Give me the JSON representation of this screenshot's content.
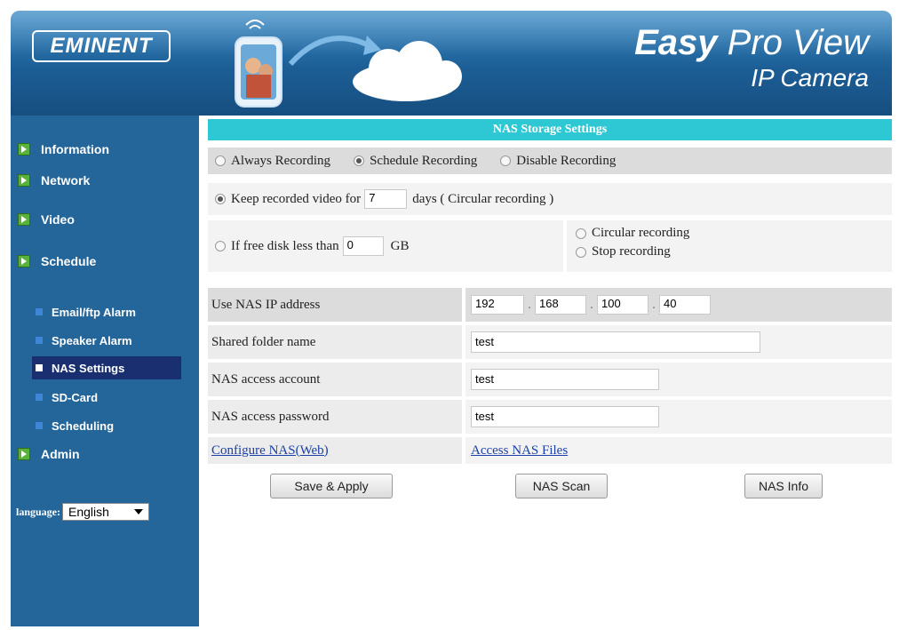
{
  "header": {
    "logo": "EMINENT",
    "brand_bold": "Easy",
    "brand_rest": " Pro View",
    "subtitle": "IP Camera"
  },
  "sidebar": {
    "items": [
      {
        "label": "Information"
      },
      {
        "label": "Network"
      },
      {
        "label": "Video"
      },
      {
        "label": "Schedule"
      },
      {
        "label": "Admin"
      }
    ],
    "sub_items": [
      {
        "label": "Email/ftp Alarm"
      },
      {
        "label": "Speaker Alarm"
      },
      {
        "label": "NAS Settings",
        "active": true
      },
      {
        "label": "SD-Card"
      },
      {
        "label": "Scheduling"
      }
    ],
    "language_label": "language:",
    "language_value": "English"
  },
  "main": {
    "title": "NAS Storage Settings",
    "mode_options": [
      "Always Recording",
      "Schedule Recording",
      "Disable Recording"
    ],
    "mode_selected": "Schedule Recording",
    "keep_label": "Keep recorded video for",
    "keep_days": "7",
    "keep_suffix": "days ( Circular recording )",
    "free_label": "If free disk less than",
    "free_value": "0",
    "free_unit": "GB",
    "free_options": [
      "Circular recording",
      "Stop recording"
    ],
    "nas_ip_label": "Use NAS IP address",
    "nas_ip": [
      "192",
      "168",
      "100",
      "40"
    ],
    "ip_sep": ".",
    "folder_label": "Shared folder name",
    "folder_value": "test",
    "account_label": "NAS access account",
    "account_value": "test",
    "password_label": "NAS access password",
    "password_value": "test",
    "configure_link": "Configure NAS(Web)",
    "access_link": "Access NAS Files",
    "save_button": "Save & Apply",
    "scan_button": "NAS Scan",
    "info_button": "NAS Info"
  },
  "colors": {
    "header": "#1c5e95",
    "sidebar": "#24659a",
    "title_bar": "#2ec8d4",
    "active_nav": "#1a2f70",
    "bullet": "#58b33b"
  },
  "icons": [
    "green-arrow-bullet-icon",
    "blue-square-bullet-icon",
    "dropdown-arrow-icon",
    "phone-family-icon",
    "cloud-icon",
    "sync-arrow-icon"
  ]
}
